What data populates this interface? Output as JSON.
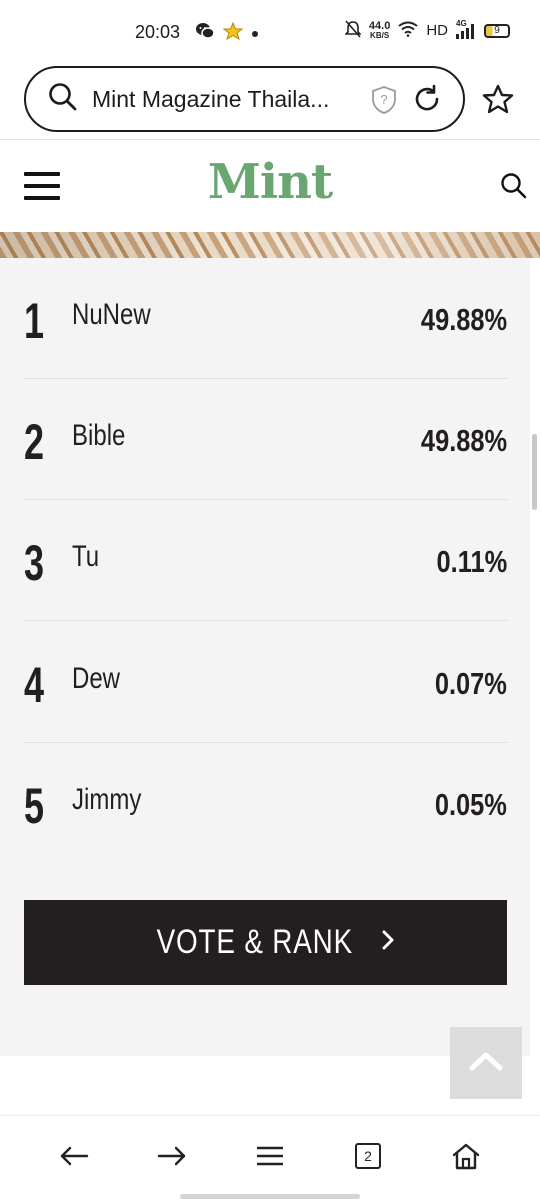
{
  "status_bar": {
    "time": "20:03",
    "net_speed_value": "44.0",
    "net_speed_unit": "KB/S",
    "hd_label": "HD",
    "network_label": "4G",
    "battery_level": "9",
    "icons": [
      "wechat-icon",
      "star-badge-icon",
      "dot-icon",
      "mute-bell-icon",
      "wifi-icon",
      "signal-icon",
      "battery-icon"
    ]
  },
  "browser": {
    "address_text": "Mint Magazine Thaila...",
    "icons": [
      "search-icon",
      "shield-question-icon",
      "reload-icon",
      "bookmark-star-icon"
    ]
  },
  "site": {
    "logo": "Mint",
    "brand_color": "#6aa672",
    "icons": [
      "hamburger-menu-icon",
      "search-icon"
    ]
  },
  "ranking": {
    "rows": [
      {
        "rank": "1",
        "name": "NuNew",
        "percent": "49.88%"
      },
      {
        "rank": "2",
        "name": "Bible",
        "percent": "49.88%"
      },
      {
        "rank": "3",
        "name": "Tu",
        "percent": "0.11%"
      },
      {
        "rank": "4",
        "name": "Dew",
        "percent": "0.07%"
      },
      {
        "rank": "5",
        "name": "Jimmy",
        "percent": "0.05%"
      }
    ],
    "vote_button_label": "VOTE & RANK",
    "button_color": "#231f20"
  },
  "bottom_nav": {
    "tab_count": "2",
    "icons": [
      "back-arrow-icon",
      "forward-arrow-icon",
      "menu-icon",
      "tabs-icon",
      "home-icon"
    ]
  }
}
